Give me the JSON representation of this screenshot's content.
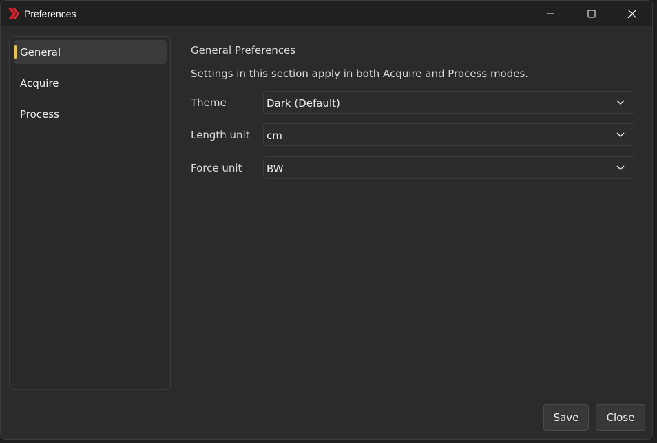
{
  "window": {
    "title": "Preferences",
    "icon": "app-logo-chevron",
    "accent_color": "#e8c05a",
    "logo_color": "#c8202a"
  },
  "sidebar": {
    "items": [
      {
        "label": "General",
        "active": true
      },
      {
        "label": "Acquire",
        "active": false
      },
      {
        "label": "Process",
        "active": false
      }
    ]
  },
  "main": {
    "section_title": "General Preferences",
    "section_description": "Settings in this section apply in both Acquire and Process modes.",
    "fields": [
      {
        "label": "Theme",
        "value": "Dark (Default)"
      },
      {
        "label": "Length unit",
        "value": "cm"
      },
      {
        "label": "Force unit",
        "value": "BW"
      }
    ]
  },
  "footer": {
    "save_label": "Save",
    "close_label": "Close"
  }
}
